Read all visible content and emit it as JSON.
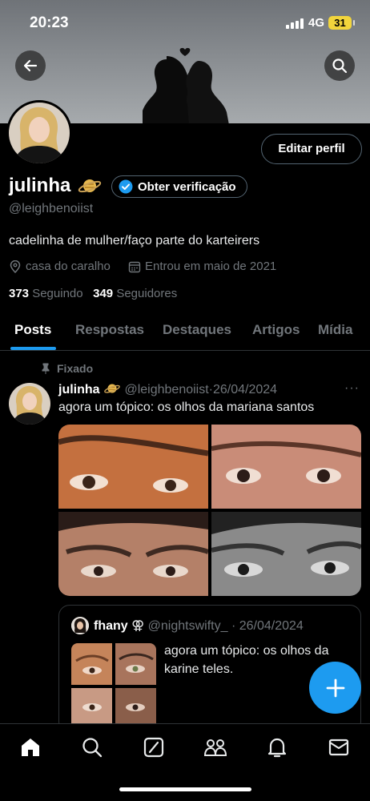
{
  "status_bar": {
    "time": "20:23",
    "network": "4G",
    "battery": "31"
  },
  "profile": {
    "display_name": "julinha",
    "name_emoji": "planet",
    "verify_label": "Obter verificação",
    "edit_label": "Editar perfil",
    "handle": "@leighbenoiist",
    "bio": "cadelinha de mulher/faço parte do karteirers",
    "location": "casa do caralho",
    "joined": "Entrou em maio de 2021",
    "following_count": "373",
    "following_label": "Seguindo",
    "followers_count": "349",
    "followers_label": "Seguidores"
  },
  "tabs": [
    {
      "label": "Posts",
      "active": true
    },
    {
      "label": "Respostas",
      "active": false
    },
    {
      "label": "Destaques",
      "active": false
    },
    {
      "label": "Artigos",
      "active": false
    },
    {
      "label": "Mídia",
      "active": false
    }
  ],
  "pinned_tweet": {
    "pinned_label": "Fixado",
    "author_name": "julinha",
    "author_handle": "@leighbenoiist",
    "date": "26/04/2024",
    "separator": "·",
    "more": "···",
    "text": "agora um tópico: os olhos da mariana santos",
    "photos": 4,
    "quote": {
      "author_name": "fhany",
      "author_symbol": "⚢",
      "author_handle": "@nightswifty_",
      "date": "26/04/2024",
      "text": "agora um tópico: os olhos da karine teles."
    }
  },
  "bottom_nav": [
    "home-icon",
    "search-icon",
    "grok-icon",
    "communities-icon",
    "notifications-icon",
    "messages-icon"
  ],
  "colors": {
    "accent": "#1d9bf0",
    "text": "#e7e9ea",
    "muted": "#71767b",
    "border": "#2f3336",
    "battery": "#f2d53c"
  }
}
